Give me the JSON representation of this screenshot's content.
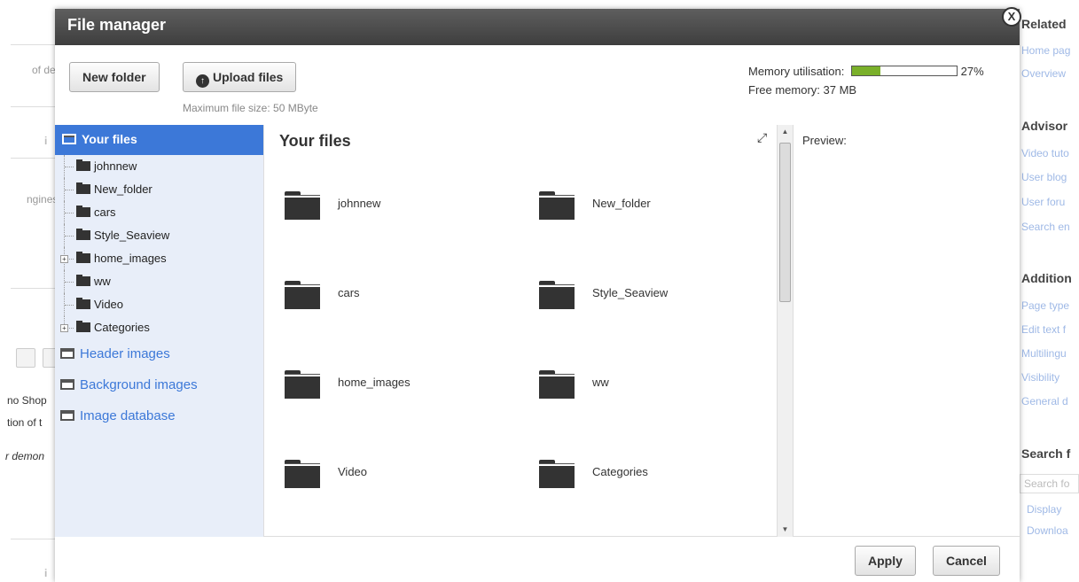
{
  "background": {
    "left_texts": [
      "of demo",
      "ngines",
      "no Shop",
      "tion of t",
      "r demon"
    ],
    "right_headings": [
      "Related",
      "Advisor",
      "Addition",
      "Search f"
    ],
    "right_links_1": [
      "Home pag",
      "Overview"
    ],
    "right_links_2": [
      "Video tuto",
      "User blog",
      "User foru",
      "Search en"
    ],
    "right_links_3": [
      "Page type",
      "Edit text f",
      "Multilingu",
      "Visibility",
      "General d"
    ],
    "right_search_placeholder": "Search fo",
    "right_links_4": [
      "Display",
      "Downloa"
    ]
  },
  "modal": {
    "title": "File manager",
    "close_label": "X"
  },
  "toolbar": {
    "new_folder_label": "New folder",
    "upload_label": "Upload files",
    "max_size_text": "Maximum file size: 50 MByte",
    "memory_label": "Memory utilisation:",
    "memory_percent": 27,
    "memory_percent_text": "27%",
    "free_memory_text": "Free memory: 37 MB"
  },
  "tree": {
    "root_label": "Your files",
    "items": [
      {
        "label": "johnnew",
        "expandable": false
      },
      {
        "label": "New_folder",
        "expandable": false
      },
      {
        "label": "cars",
        "expandable": false
      },
      {
        "label": "Style_Seaview",
        "expandable": false
      },
      {
        "label": "home_images",
        "expandable": true
      },
      {
        "label": "ww",
        "expandable": false
      },
      {
        "label": "Video",
        "expandable": false
      },
      {
        "label": "Categories",
        "expandable": true
      }
    ],
    "links": [
      "Header images",
      "Background images",
      "Image database"
    ]
  },
  "files": {
    "title": "Your files",
    "folders": [
      "johnnew",
      "New_folder",
      "cars",
      "Style_Seaview",
      "home_images",
      "ww",
      "Video",
      "Categories"
    ]
  },
  "preview": {
    "label": "Preview:"
  },
  "footer": {
    "apply_label": "Apply",
    "cancel_label": "Cancel"
  },
  "colors": {
    "accent": "#3c78d8",
    "memory_fill": "#7ab02a",
    "header_bg": "#4a4a4a"
  }
}
